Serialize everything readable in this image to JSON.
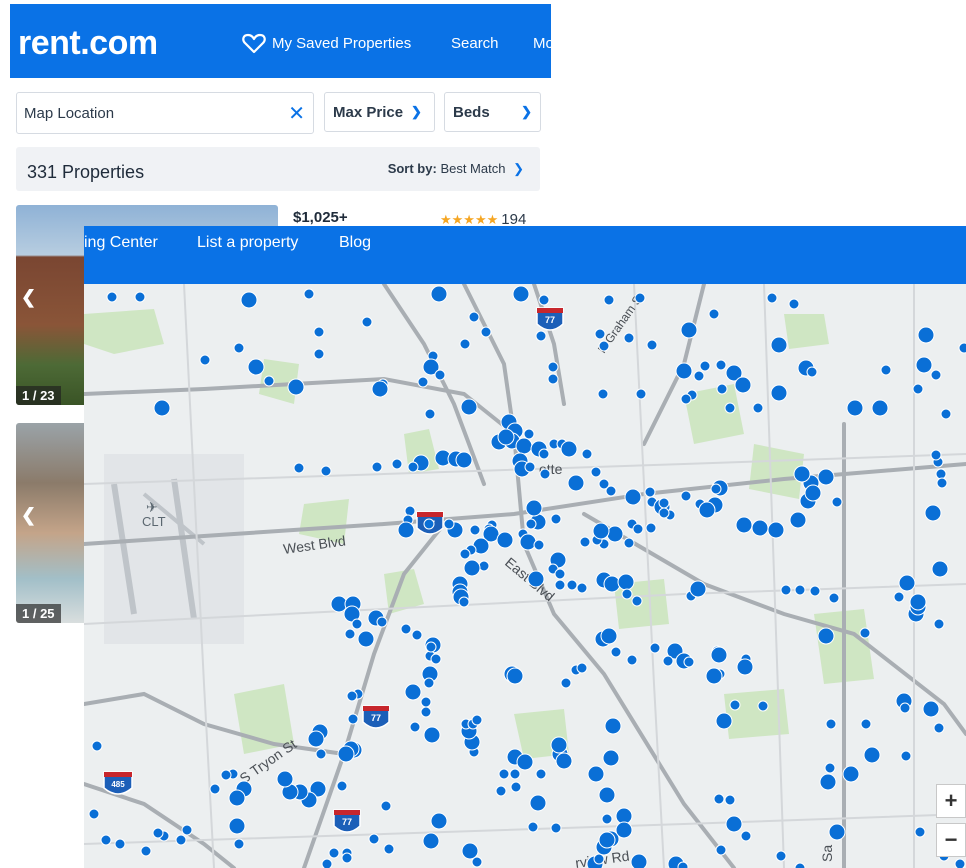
{
  "top_window": {
    "logo": "rent.com",
    "nav": {
      "saved": "My Saved Properties",
      "search": "Search",
      "more": "Mo"
    },
    "location_placeholder": "Map Location",
    "filters": {
      "max_price": "Max Price",
      "beds": "Beds"
    },
    "results": {
      "count": "331 Properties",
      "sort_label": "Sort by:",
      "sort_value": "Best Match"
    },
    "listings": [
      {
        "price": "$1,025+",
        "stars": "★★★★★",
        "reviews": "194",
        "photo_count": "1 / 23"
      },
      {
        "photo_count": "1 / 25"
      }
    ]
  },
  "map_window": {
    "nav": [
      "ing Center",
      "List a property",
      "Blog"
    ],
    "map_labels": {
      "west_blvd": "West Blvd",
      "east_blvd": "East Blvd",
      "n_graham": "N Graham St",
      "s_tryon": "S Tryon St",
      "clt": "CLT",
      "charlotte": "otte",
      "fairview": "rview Rd",
      "sa": "Sa"
    },
    "shields": {
      "i77": "77",
      "i485": "485"
    },
    "zoom": {
      "in": "+",
      "out": "−"
    }
  },
  "colors": {
    "brand_blue": "#0a72e6",
    "marker_blue": "#0a6fd6",
    "star_gold": "#f5a623"
  }
}
